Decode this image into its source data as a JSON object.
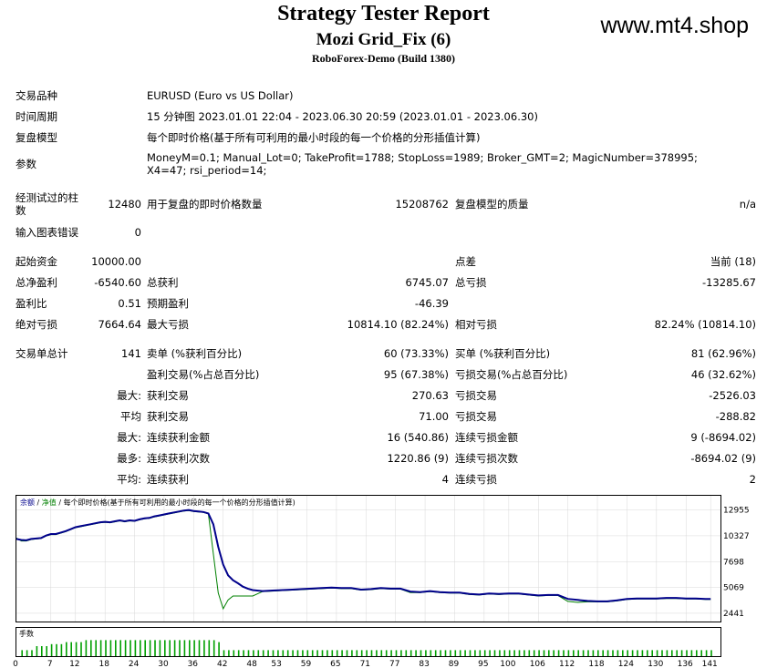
{
  "header": {
    "title": "Strategy Tester Report",
    "subtitle": "Mozi Grid_Fix (6)",
    "build": "RoboForex-Demo (Build 1380)",
    "watermark": "www.mt4.shop"
  },
  "info": {
    "symbol_label": "交易品种",
    "symbol_value": "EURUSD (Euro vs US Dollar)",
    "period_label": "时间周期",
    "period_value": "15 分钟图 2023.01.01 22:04 - 2023.06.30 20:59 (2023.01.01 - 2023.06.30)",
    "model_label": "复盘模型",
    "model_value": "每个即时价格(基于所有可利用的最小时段的每一个价格的分形插值计算)",
    "params_label": "参数",
    "params_value": "MoneyM=0.1; Manual_Lot=0; TakeProfit=1788; StopLoss=1989; Broker_GMT=2; MagicNumber=378995; X4=47; rsi_period=14;"
  },
  "bars": {
    "bars_label_1": "经测试过的柱",
    "bars_label_2": "数",
    "bars_value": "12480",
    "ticks_label": "用于复盘的即时价格数量",
    "ticks_value": "15208762",
    "quality_label": "复盘模型的质量",
    "quality_value": "n/a",
    "errors_label": "输入图表错误",
    "errors_value": "0"
  },
  "stats": {
    "deposit_label": "起始资金",
    "deposit_value": "10000.00",
    "spread_label": "点差",
    "spread_value": "当前 (18)",
    "netprofit_label": "总净盈利",
    "netprofit_value": "-6540.60",
    "grossprofit_label": "总获利",
    "grossprofit_value": "6745.07",
    "grossloss_label": "总亏损",
    "grossloss_value": "-13285.67",
    "pf_label": "盈利比",
    "pf_value": "0.51",
    "payoff_label": "预期盈利",
    "payoff_value": "-46.39",
    "absdd_label": "绝对亏损",
    "absdd_value": "7664.64",
    "maxdd_label": "最大亏损",
    "maxdd_value": "10814.10 (82.24%)",
    "reldd_label": "相对亏损",
    "reldd_value": "82.24% (10814.10)",
    "trades_label": "交易单总计",
    "trades_value": "141",
    "short_label": "卖单 (%获利百分比)",
    "short_value": "60 (73.33%)",
    "long_label": "买单 (%获利百分比)",
    "long_value": "81 (62.96%)",
    "profit_trades_label": "盈利交易(%占总百分比)",
    "profit_trades_value": "95 (67.38%)",
    "loss_trades_label": "亏损交易(%占总百分比)",
    "loss_trades_value": "46 (32.62%)",
    "largest_prefix": "最大:",
    "largest_profit_label": "获利交易",
    "largest_profit_value": "270.63",
    "largest_loss_label": "亏损交易",
    "largest_loss_value": "-2526.03",
    "average_prefix": "平均",
    "average_profit_label": "获利交易",
    "average_profit_value": "71.00",
    "average_loss_label": "亏损交易",
    "average_loss_value": "-288.82",
    "maxcons_prefix": "最大:",
    "maxcons_wins_label": "连续获利金额",
    "maxcons_wins_value": "16 (540.86)",
    "maxcons_losses_label": "连续亏损金额",
    "maxcons_losses_value": "9 (-8694.02)",
    "maxconsamt_prefix": "最多:",
    "maxconsamt_profit_label": "连续获利次数",
    "maxconsamt_profit_value": "1220.86 (9)",
    "maxconsamt_loss_label": "连续亏损次数",
    "maxconsamt_loss_value": "-8694.02 (9)",
    "avgcons_prefix": "平均:",
    "avgcons_wins_label": "连续获利",
    "avgcons_wins_value": "4",
    "avgcons_losses_label": "连续亏损",
    "avgcons_losses_value": "2"
  },
  "chart_data": {
    "type": "line",
    "legend_balance": "余额",
    "legend_sep1": " / ",
    "legend_equity": "净值",
    "legend_sep2": " / ",
    "legend_model": "每个即时价格(基于所有可利用的最小时段的每一个价格的分形插值计算)",
    "y_ticks": [
      "12955",
      "10327",
      "7698",
      "5069",
      "2441"
    ],
    "x_ticks": [
      "0",
      "7",
      "12",
      "18",
      "24",
      "30",
      "36",
      "42",
      "48",
      "53",
      "59",
      "65",
      "71",
      "77",
      "83",
      "89",
      "95",
      "100",
      "106",
      "112",
      "118",
      "124",
      "130",
      "136",
      "141"
    ],
    "ylim": [
      1600,
      14400
    ],
    "xlim": [
      0,
      143
    ],
    "balance_color": "#00008b",
    "equity_color": "#008000",
    "lot_bar_color": "#00a000",
    "lot_label": "手数",
    "balance": [
      [
        0,
        10000
      ],
      [
        1,
        9900
      ],
      [
        2,
        9860
      ],
      [
        3,
        10000
      ],
      [
        4,
        10050
      ],
      [
        5,
        10100
      ],
      [
        6,
        10350
      ],
      [
        7,
        10500
      ],
      [
        8,
        10500
      ],
      [
        9,
        10650
      ],
      [
        10,
        10800
      ],
      [
        11,
        11000
      ],
      [
        12,
        11200
      ],
      [
        13,
        11300
      ],
      [
        14,
        11400
      ],
      [
        15,
        11500
      ],
      [
        16,
        11600
      ],
      [
        17,
        11700
      ],
      [
        18,
        11750
      ],
      [
        19,
        11700
      ],
      [
        20,
        11800
      ],
      [
        21,
        11900
      ],
      [
        22,
        11800
      ],
      [
        23,
        11900
      ],
      [
        24,
        11850
      ],
      [
        25,
        12000
      ],
      [
        26,
        12100
      ],
      [
        27,
        12150
      ],
      [
        28,
        12300
      ],
      [
        29,
        12400
      ],
      [
        30,
        12500
      ],
      [
        31,
        12600
      ],
      [
        32,
        12700
      ],
      [
        33,
        12800
      ],
      [
        34,
        12900
      ],
      [
        35,
        12950
      ],
      [
        36,
        12850
      ],
      [
        37,
        12800
      ],
      [
        38,
        12750
      ],
      [
        39,
        12600
      ],
      [
        40,
        11500
      ],
      [
        41,
        9200
      ],
      [
        42,
        7400
      ],
      [
        43,
        6300
      ],
      [
        44,
        5800
      ],
      [
        45,
        5500
      ],
      [
        46,
        5150
      ],
      [
        47,
        4950
      ],
      [
        48,
        4800
      ],
      [
        50,
        4700
      ],
      [
        52,
        4750
      ],
      [
        54,
        4800
      ],
      [
        56,
        4850
      ],
      [
        58,
        4900
      ],
      [
        60,
        4950
      ],
      [
        62,
        5000
      ],
      [
        64,
        5050
      ],
      [
        66,
        5000
      ],
      [
        68,
        5000
      ],
      [
        70,
        4850
      ],
      [
        72,
        4900
      ],
      [
        74,
        5000
      ],
      [
        76,
        4950
      ],
      [
        78,
        4950
      ],
      [
        80,
        4650
      ],
      [
        82,
        4600
      ],
      [
        84,
        4700
      ],
      [
        86,
        4600
      ],
      [
        88,
        4550
      ],
      [
        90,
        4550
      ],
      [
        92,
        4400
      ],
      [
        94,
        4350
      ],
      [
        96,
        4450
      ],
      [
        98,
        4400
      ],
      [
        100,
        4450
      ],
      [
        102,
        4450
      ],
      [
        104,
        4350
      ],
      [
        106,
        4250
      ],
      [
        108,
        4300
      ],
      [
        110,
        4300
      ],
      [
        112,
        3900
      ],
      [
        114,
        3800
      ],
      [
        116,
        3700
      ],
      [
        118,
        3650
      ],
      [
        120,
        3650
      ],
      [
        122,
        3750
      ],
      [
        124,
        3900
      ],
      [
        126,
        3950
      ],
      [
        128,
        3950
      ],
      [
        130,
        3950
      ],
      [
        132,
        4000
      ],
      [
        134,
        4000
      ],
      [
        136,
        3950
      ],
      [
        138,
        3950
      ],
      [
        140,
        3900
      ],
      [
        141,
        3900
      ]
    ],
    "equity": [
      [
        0,
        10100
      ],
      [
        1,
        9800
      ],
      [
        2,
        9800
      ],
      [
        3,
        9950
      ],
      [
        4,
        10000
      ],
      [
        5,
        10050
      ],
      [
        6,
        10300
      ],
      [
        7,
        10450
      ],
      [
        8,
        10450
      ],
      [
        9,
        10600
      ],
      [
        10,
        10750
      ],
      [
        11,
        10950
      ],
      [
        12,
        11150
      ],
      [
        13,
        11250
      ],
      [
        14,
        11350
      ],
      [
        15,
        11450
      ],
      [
        16,
        11550
      ],
      [
        17,
        11650
      ],
      [
        18,
        11700
      ],
      [
        19,
        11650
      ],
      [
        20,
        11750
      ],
      [
        21,
        11850
      ],
      [
        22,
        11750
      ],
      [
        23,
        11850
      ],
      [
        24,
        11800
      ],
      [
        25,
        11950
      ],
      [
        26,
        12050
      ],
      [
        27,
        12100
      ],
      [
        28,
        12250
      ],
      [
        29,
        12350
      ],
      [
        30,
        12450
      ],
      [
        31,
        12550
      ],
      [
        32,
        12650
      ],
      [
        33,
        12750
      ],
      [
        34,
        12850
      ],
      [
        35,
        12900
      ],
      [
        36,
        12800
      ],
      [
        37,
        12750
      ],
      [
        38,
        12700
      ],
      [
        39,
        12550
      ],
      [
        40,
        8500
      ],
      [
        41,
        4500
      ],
      [
        42,
        2900
      ],
      [
        43,
        3800
      ],
      [
        44,
        4200
      ],
      [
        45,
        4200
      ],
      [
        46,
        4200
      ],
      [
        47,
        4200
      ],
      [
        48,
        4200
      ],
      [
        50,
        4650
      ],
      [
        52,
        4700
      ],
      [
        54,
        4750
      ],
      [
        56,
        4800
      ],
      [
        58,
        4850
      ],
      [
        60,
        4900
      ],
      [
        62,
        4950
      ],
      [
        64,
        5000
      ],
      [
        66,
        4950
      ],
      [
        68,
        4950
      ],
      [
        70,
        4800
      ],
      [
        72,
        4850
      ],
      [
        74,
        4950
      ],
      [
        76,
        4900
      ],
      [
        78,
        4900
      ],
      [
        80,
        4550
      ],
      [
        82,
        4550
      ],
      [
        84,
        4650
      ],
      [
        86,
        4550
      ],
      [
        88,
        4500
      ],
      [
        90,
        4500
      ],
      [
        92,
        4350
      ],
      [
        94,
        4300
      ],
      [
        96,
        4400
      ],
      [
        98,
        4350
      ],
      [
        100,
        4400
      ],
      [
        102,
        4400
      ],
      [
        104,
        4300
      ],
      [
        106,
        4200
      ],
      [
        108,
        4250
      ],
      [
        110,
        4250
      ],
      [
        112,
        3650
      ],
      [
        114,
        3550
      ],
      [
        116,
        3600
      ],
      [
        118,
        3600
      ],
      [
        120,
        3600
      ],
      [
        122,
        3700
      ],
      [
        124,
        3850
      ],
      [
        126,
        3900
      ],
      [
        128,
        3900
      ],
      [
        130,
        3900
      ],
      [
        132,
        3950
      ],
      [
        134,
        3950
      ],
      [
        136,
        3900
      ],
      [
        138,
        3900
      ],
      [
        140,
        3850
      ],
      [
        141,
        3850
      ]
    ],
    "lots": [
      0.3,
      0.3,
      0.3,
      0.5,
      0.5,
      0.5,
      0.6,
      0.6,
      0.6,
      0.7,
      0.7,
      0.7,
      0.7,
      0.8,
      0.8,
      0.8,
      0.8,
      0.8,
      0.8,
      0.8,
      0.8,
      0.8,
      0.8,
      0.8,
      0.8,
      0.8,
      0.8,
      0.8,
      0.8,
      0.8,
      0.8,
      0.8,
      0.8,
      0.8,
      0.8,
      0.8,
      0.8,
      0.8,
      0.8,
      0.8,
      0.7,
      0.3,
      0.3,
      0.3,
      0.3,
      0.3,
      0.3,
      0.3,
      0.3,
      0.3,
      0.3,
      0.3,
      0.3,
      0.3,
      0.3,
      0.3,
      0.3,
      0.3,
      0.3,
      0.3,
      0.3,
      0.3,
      0.3,
      0.3,
      0.3,
      0.3,
      0.3,
      0.3,
      0.3,
      0.3,
      0.3,
      0.3,
      0.3,
      0.3,
      0.3,
      0.3,
      0.3,
      0.3,
      0.3,
      0.3,
      0.3,
      0.3,
      0.3,
      0.3,
      0.3,
      0.3,
      0.3,
      0.3,
      0.3,
      0.3,
      0.3,
      0.3,
      0.3,
      0.3,
      0.3,
      0.3,
      0.3,
      0.3,
      0.3,
      0.3,
      0.3,
      0.3,
      0.3,
      0.3,
      0.3,
      0.3,
      0.3,
      0.3,
      0.3,
      0.3,
      0.3,
      0.3,
      0.3,
      0.3,
      0.3,
      0.3,
      0.3,
      0.3,
      0.3,
      0.3,
      0.3,
      0.3,
      0.3,
      0.3,
      0.3,
      0.3,
      0.3,
      0.3,
      0.3,
      0.3,
      0.3,
      0.3,
      0.3,
      0.3,
      0.3,
      0.3,
      0.3,
      0.3,
      0.3,
      0.3,
      0.3
    ]
  }
}
